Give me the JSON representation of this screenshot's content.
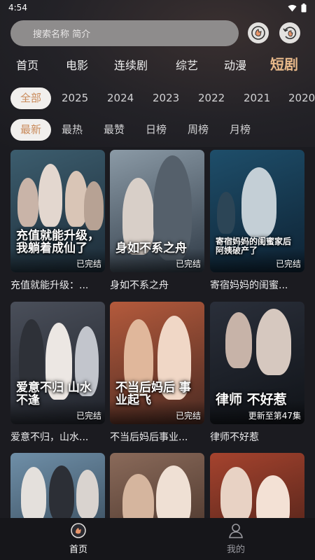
{
  "status_bar": {
    "time": "4:54"
  },
  "search": {
    "placeholder": "搜索名称 简介"
  },
  "header_icons": {
    "left": "history-hand-icon",
    "right": "refresh-clock-icon"
  },
  "nav_tabs": [
    {
      "label": "首页"
    },
    {
      "label": "电影"
    },
    {
      "label": "连续剧"
    },
    {
      "label": "综艺"
    },
    {
      "label": "动漫"
    },
    {
      "label": "短剧",
      "active": true
    }
  ],
  "year_filters": [
    {
      "label": "全部",
      "active": true
    },
    {
      "label": "2025"
    },
    {
      "label": "2024"
    },
    {
      "label": "2023"
    },
    {
      "label": "2022"
    },
    {
      "label": "2021"
    },
    {
      "label": "2020"
    }
  ],
  "sort_filters": [
    {
      "label": "最新",
      "active": true
    },
    {
      "label": "最热"
    },
    {
      "label": "最赞"
    },
    {
      "label": "日榜"
    },
    {
      "label": "周榜"
    },
    {
      "label": "月榜"
    }
  ],
  "cards": [
    {
      "title": "充值就能升级：...",
      "badge": "已完结",
      "poster_text": "充值就能升级，我躺着成仙了",
      "colors": [
        "#3c5d6e",
        "#1d2c38"
      ]
    },
    {
      "title": "身如不系之舟",
      "badge": "已完结",
      "poster_text": "身如不系之舟",
      "colors": [
        "#8b9aa6",
        "#2f3a46"
      ]
    },
    {
      "title": "寄宿妈妈的闺蜜...",
      "badge": "已完结",
      "poster_text": "寄宿妈妈的闺蜜家后 阿姨破产了",
      "colors": [
        "#1e4e6a",
        "#0e2233"
      ]
    },
    {
      "title": "爱意不归，山水...",
      "badge": "已完结",
      "poster_text": "爱意不归 山水不逢",
      "colors": [
        "#4a4f5a",
        "#20232b"
      ]
    },
    {
      "title": "不当后妈后事业...",
      "badge": "已完结",
      "poster_text": "不当后妈后 事业起飞",
      "colors": [
        "#b45a3c",
        "#4a2a22"
      ]
    },
    {
      "title": "律师不好惹",
      "badge": "更新至第47集",
      "poster_text": "律师 不好惹",
      "colors": [
        "#2a2f3a",
        "#101318"
      ]
    },
    {
      "title": "",
      "badge": "",
      "poster_text": "",
      "colors": [
        "#6f8fa8",
        "#2a3a48"
      ]
    },
    {
      "title": "",
      "badge": "",
      "poster_text": "",
      "colors": [
        "#8a6a5a",
        "#3a2820"
      ]
    },
    {
      "title": "",
      "badge": "",
      "poster_text": "",
      "colors": [
        "#a5432e",
        "#3b1a14"
      ]
    }
  ],
  "bottom_nav": [
    {
      "label": "首页",
      "icon": "home-icon",
      "active": true,
      "color": "#ffffff"
    },
    {
      "label": "我的",
      "icon": "profile-icon",
      "active": false,
      "color": "#9a9aa0"
    }
  ],
  "accent_color": "#e8b98a"
}
